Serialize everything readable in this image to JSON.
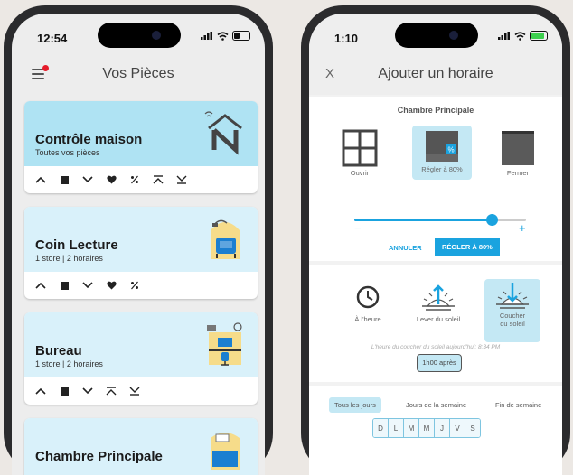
{
  "left_phone": {
    "status_time": "12:54",
    "title": "Vos Pièces",
    "cards": [
      {
        "title": "Contrôle maison",
        "subtitle": "Toutes vos pièces"
      },
      {
        "title": "Coin Lecture",
        "subtitle": "1 store | 2 horaires"
      },
      {
        "title": "Bureau",
        "subtitle": "1 store | 2 horaires"
      },
      {
        "title": "Chambre Principale",
        "subtitle": ""
      }
    ],
    "control_glyphs": {
      "up": "⌃",
      "stop": "■",
      "down": "⌄",
      "favorite": "♥",
      "percent": "%",
      "top": "⌅",
      "bottom": "⌄̲"
    }
  },
  "right_phone": {
    "status_time": "1:10",
    "close_label": "X",
    "title": "Ajouter un horaire",
    "room_name": "Chambre Principale",
    "options": [
      {
        "label": "Ouvrir"
      },
      {
        "label": "Régler à 80%"
      },
      {
        "label": "Fermer"
      }
    ],
    "slider_value_percent": 80,
    "slider_minus": "−",
    "slider_plus": "+",
    "cancel_label": "ANNULER",
    "confirm_label": "RÉGLER À 80%",
    "time_options": [
      {
        "label": "À l'heure"
      },
      {
        "label": "Lever du soleil"
      },
      {
        "label_line1": "Coucher",
        "label_line2": "du soleil"
      }
    ],
    "sunset_info": "L'heure du coucher du soleil aujourd'hui: 8:34 PM",
    "offset_label": "1h00 après",
    "day_modes": [
      "Tous les jours",
      "Jours de la semaine",
      "Fin de semaine"
    ],
    "days": [
      "D",
      "L",
      "M",
      "M",
      "J",
      "V",
      "S"
    ]
  },
  "colors": {
    "accent": "#1aa3df",
    "notification": "#e51c2a",
    "card_bg": "#d9f1fa",
    "card_bg_active": "#afe3f3"
  }
}
